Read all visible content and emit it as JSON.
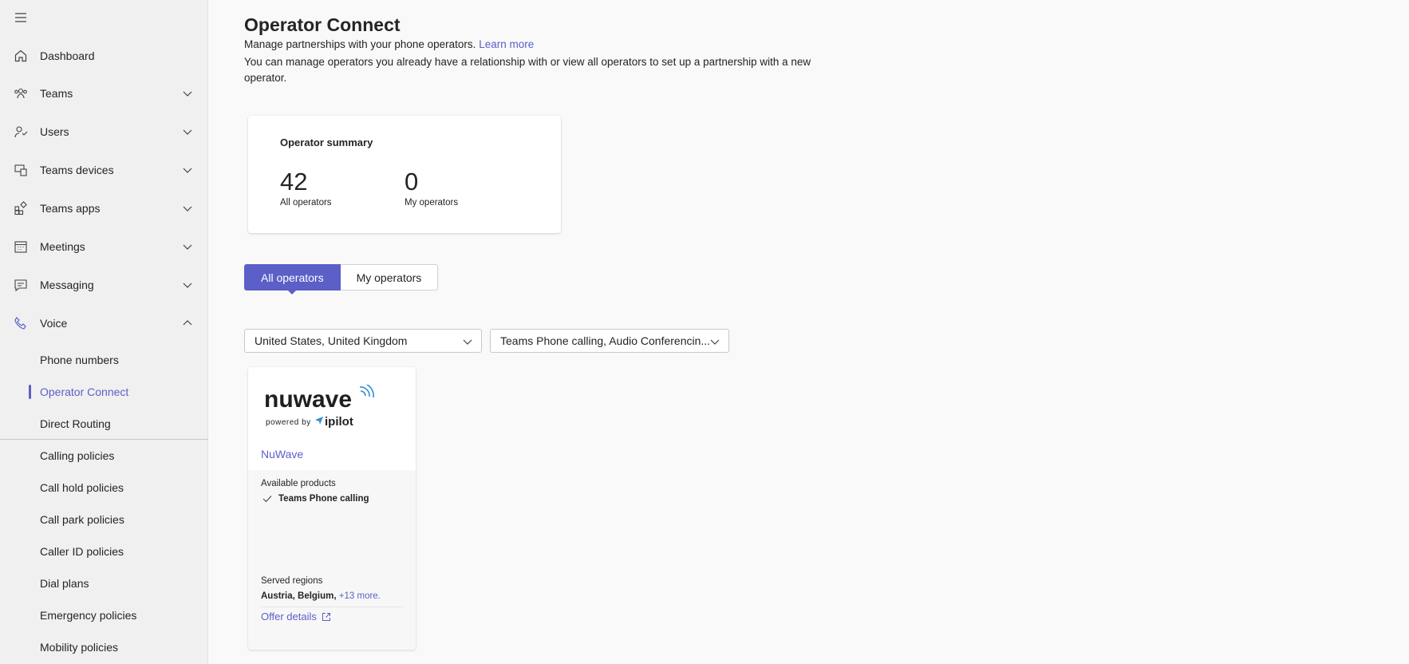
{
  "sidebar": {
    "items": [
      {
        "label": "Dashboard",
        "icon": "home-icon"
      },
      {
        "label": "Teams",
        "icon": "teams-icon"
      },
      {
        "label": "Users",
        "icon": "users-icon"
      },
      {
        "label": "Teams devices",
        "icon": "devices-icon"
      },
      {
        "label": "Teams apps",
        "icon": "apps-icon"
      },
      {
        "label": "Meetings",
        "icon": "calendar-icon"
      },
      {
        "label": "Messaging",
        "icon": "chat-icon"
      },
      {
        "label": "Voice",
        "icon": "phone-icon"
      }
    ],
    "voice_sub_items": [
      {
        "label": "Phone numbers"
      },
      {
        "label": "Operator Connect",
        "active": true
      },
      {
        "label": "Direct Routing"
      },
      {
        "label": "Calling policies"
      },
      {
        "label": "Call hold policies"
      },
      {
        "label": "Call park policies"
      },
      {
        "label": "Caller ID policies"
      },
      {
        "label": "Dial plans"
      },
      {
        "label": "Emergency policies"
      },
      {
        "label": "Mobility policies"
      }
    ]
  },
  "main": {
    "title": "Operator Connect",
    "description_line1": "Manage partnerships with your phone operators.",
    "learn_more": "Learn more",
    "description_line2": "You can manage operators you already have a relationship with or view all operators to set up a partnership with a new operator.",
    "summary": {
      "title": "Operator summary",
      "all_count": "42",
      "all_label": "All operators",
      "my_count": "0",
      "my_label": "My operators"
    },
    "tabs": [
      {
        "label": "All operators",
        "selected": true
      },
      {
        "label": "My operators",
        "selected": false
      }
    ],
    "filters": {
      "region": "United States, United Kingdom",
      "products": "Teams Phone calling, Audio Conferencin..."
    },
    "operator_card": {
      "logo_word": "nuwave",
      "logo_tagline": "powered by",
      "logo_brand": "ipilot",
      "name": "NuWave",
      "available_label": "Available products",
      "product": "Teams Phone calling",
      "served_label": "Served regions",
      "regions": "Austria, Belgium,",
      "more": "+13 more.",
      "offer_link": "Offer details"
    }
  },
  "colors": {
    "accent": "#5b5fc7",
    "sidebar_bg": "#f0f0f0",
    "page_bg": "#f9f9f9"
  }
}
